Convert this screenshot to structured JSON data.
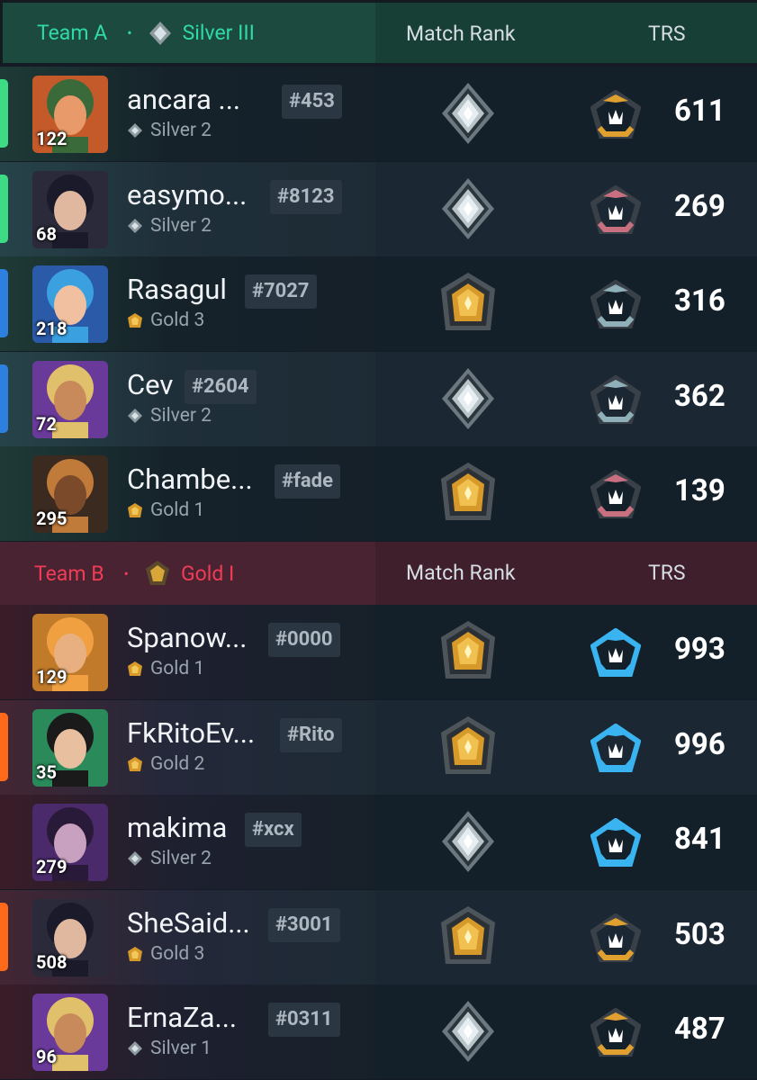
{
  "team_a": {
    "label": "Team A",
    "rank": "Silver III",
    "rank_icon": "silver-rank-icon",
    "col_match_rank": "Match Rank",
    "col_trs": "TRS",
    "color": "#30d9a8",
    "players": [
      {
        "name": "ancara ...",
        "tag": "#453",
        "level": "122",
        "small_rank": "Silver 2",
        "match_rank_icon": "silver-rank-icon",
        "trs": "611",
        "trs_icon": "gold-trs-icon",
        "accent": "#3ddc84"
      },
      {
        "name": "easymo...",
        "tag": "#8123",
        "level": "68",
        "small_rank": "Silver 2",
        "match_rank_icon": "silver-rank-icon",
        "trs": "269",
        "trs_icon": "iron-trs-icon",
        "accent": "#3ddc84"
      },
      {
        "name": "Rasagul",
        "tag": "#7027",
        "level": "218",
        "small_rank": "Gold 3",
        "match_rank_icon": "gold-rank-icon",
        "trs": "316",
        "trs_icon": "steel-trs-icon",
        "accent": "#2d7fe0"
      },
      {
        "name": "Cev",
        "tag": "#2604",
        "level": "72",
        "small_rank": "Silver 2",
        "match_rank_icon": "silver-rank-icon",
        "trs": "362",
        "trs_icon": "steel-trs-icon",
        "accent": "#2d7fe0"
      },
      {
        "name": "Chambe...",
        "tag": "#fade",
        "level": "295",
        "small_rank": "Gold 1",
        "match_rank_icon": "gold-rank-icon",
        "trs": "139",
        "trs_icon": "iron-trs-icon",
        "accent": ""
      }
    ]
  },
  "team_b": {
    "label": "Team B",
    "rank": "Gold I",
    "rank_icon": "gold-rank-icon",
    "col_match_rank": "Match Rank",
    "col_trs": "TRS",
    "color": "#f03c55",
    "players": [
      {
        "name": "Spanow...",
        "tag": "#0000",
        "level": "129",
        "small_rank": "Gold 1",
        "match_rank_icon": "gold-rank-icon",
        "trs": "993",
        "trs_icon": "diamond-trs-icon",
        "accent": ""
      },
      {
        "name": "FkRitoEv...",
        "tag": "#Rito",
        "level": "35",
        "small_rank": "Gold 2",
        "match_rank_icon": "gold-rank-icon",
        "trs": "996",
        "trs_icon": "diamond-trs-icon",
        "accent": "#ff6a1a"
      },
      {
        "name": "makima",
        "tag": "#xcx",
        "level": "279",
        "small_rank": "Silver 2",
        "match_rank_icon": "silver-rank-icon",
        "trs": "841",
        "trs_icon": "diamond-trs-icon",
        "accent": ""
      },
      {
        "name": "SheSaid...",
        "tag": "#3001",
        "level": "508",
        "small_rank": "Gold 3",
        "match_rank_icon": "gold-rank-icon",
        "trs": "503",
        "trs_icon": "gold-trs-icon",
        "accent": "#ff6a1a"
      },
      {
        "name": "ErnaZa...",
        "tag": "#0311",
        "level": "96",
        "small_rank": "Silver 1",
        "match_rank_icon": "silver-rank-icon",
        "trs": "487",
        "trs_icon": "gold-trs-icon",
        "accent": ""
      }
    ]
  }
}
